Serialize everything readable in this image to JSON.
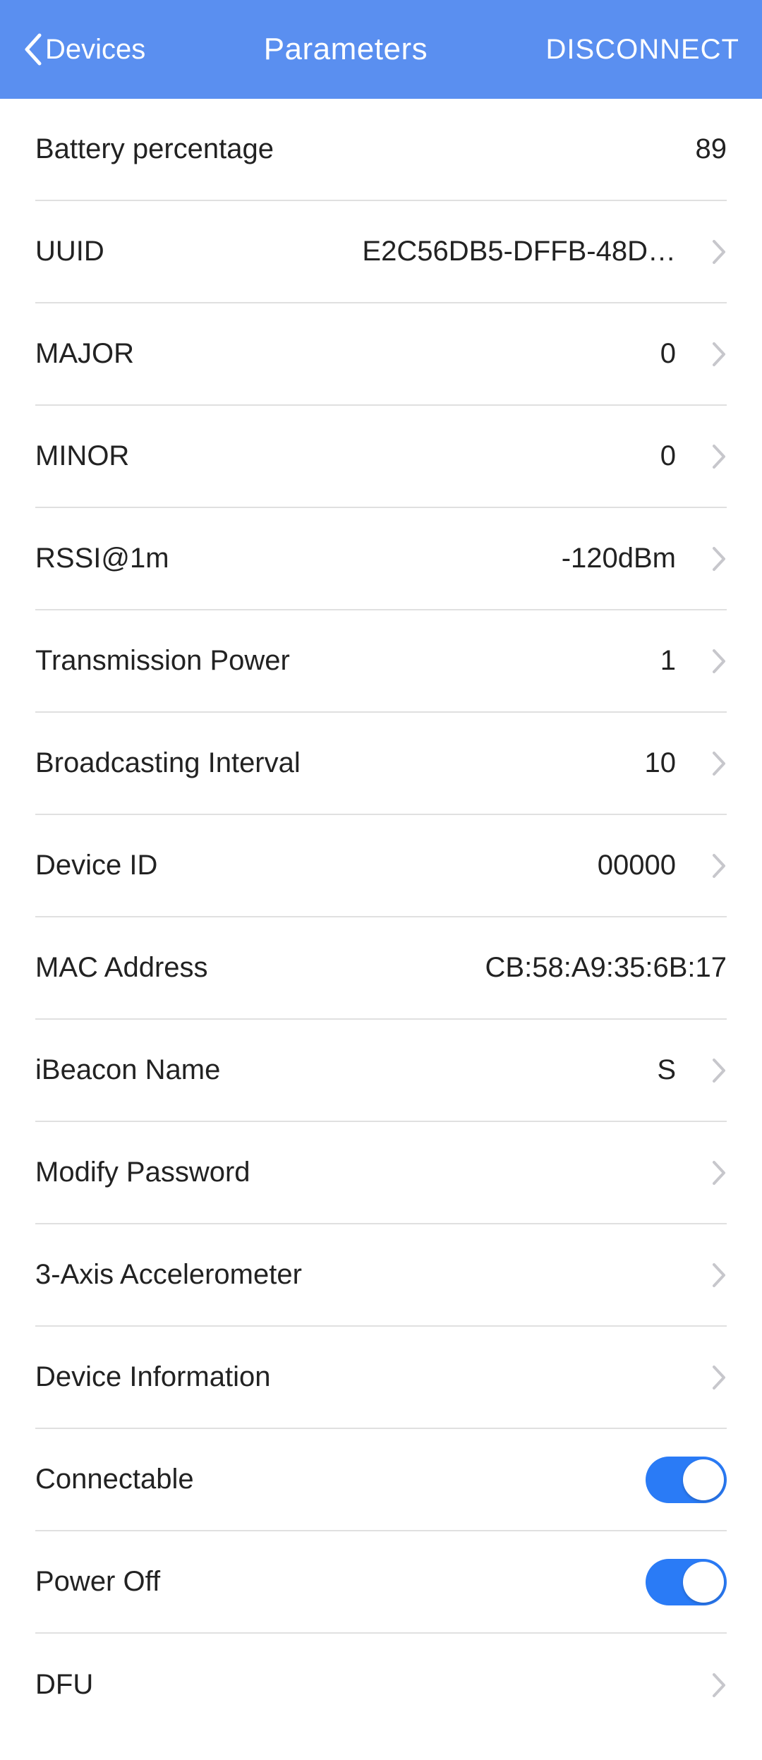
{
  "header": {
    "back_label": "Devices",
    "title": "Parameters",
    "disconnect_label": "DISCONNECT"
  },
  "rows": {
    "battery": {
      "label": "Battery percentage",
      "value": "89"
    },
    "uuid": {
      "label": "UUID",
      "value": "E2C56DB5-DFFB-48D…"
    },
    "major": {
      "label": "MAJOR",
      "value": "0"
    },
    "minor": {
      "label": "MINOR",
      "value": "0"
    },
    "rssi": {
      "label": "RSSI@1m",
      "value": "-120dBm"
    },
    "txpower": {
      "label": "Transmission Power",
      "value": "1"
    },
    "interval": {
      "label": "Broadcasting Interval",
      "value": "10"
    },
    "deviceid": {
      "label": "Device ID",
      "value": "00000"
    },
    "mac": {
      "label": "MAC Address",
      "value": "CB:58:A9:35:6B:17"
    },
    "name": {
      "label": "iBeacon Name",
      "value": "S"
    },
    "password": {
      "label": "Modify Password",
      "value": ""
    },
    "accel": {
      "label": "3-Axis Accelerometer",
      "value": ""
    },
    "info": {
      "label": "Device Information",
      "value": ""
    },
    "connect": {
      "label": "Connectable"
    },
    "poweroff": {
      "label": "Power Off"
    },
    "dfu": {
      "label": "DFU",
      "value": ""
    }
  },
  "toggles": {
    "connectable": true,
    "poweroff": true
  }
}
